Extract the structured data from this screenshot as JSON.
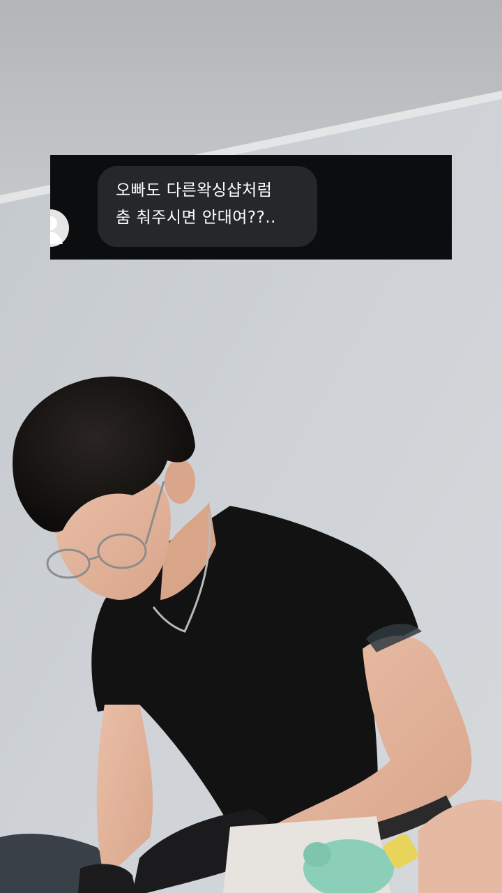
{
  "comment": {
    "lines": [
      "오빠도 다른왁싱샵처럼",
      "춤 춰주시면 안대여??.."
    ]
  },
  "colors": {
    "card_background": "#0b0d0f",
    "bubble_background": "#25282b",
    "bubble_text": "#ffffff",
    "avatar_background": "#e6e6e6",
    "avatar_silhouette": "#ffffff"
  },
  "icons": {
    "avatar": "default-user-silhouette-icon"
  }
}
